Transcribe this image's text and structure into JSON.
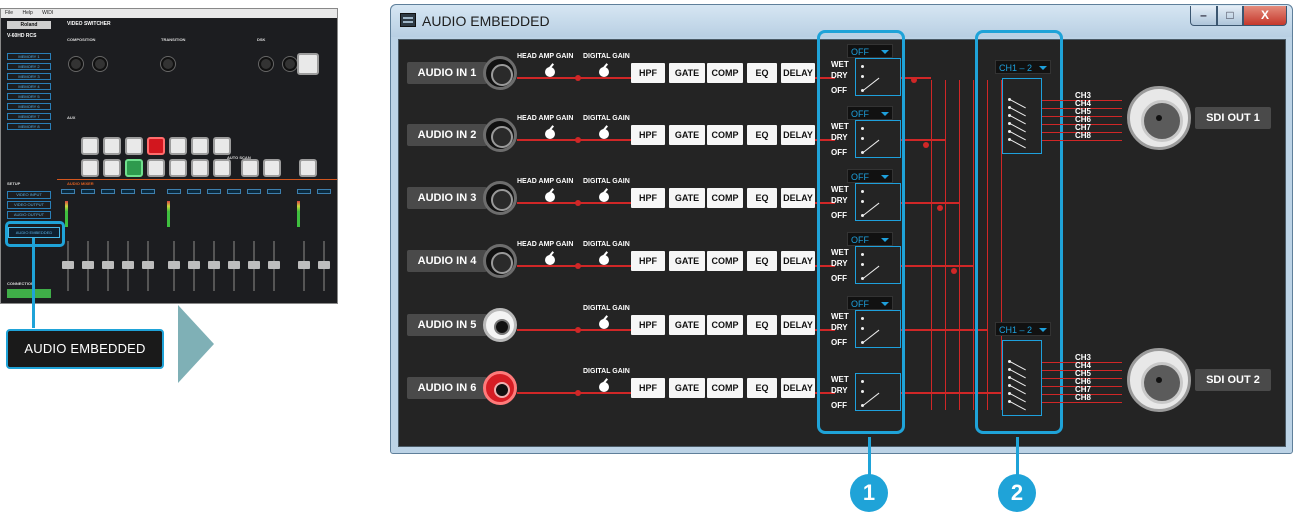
{
  "thumbnail": {
    "menu": [
      "File",
      "Help",
      "WIDI"
    ],
    "title": "VIDEO SWITCHER",
    "brand": "Roland",
    "model": "V-60HD RCS",
    "memory_items": [
      "MEMORY 1",
      "MEMORY 2",
      "MEMORY 3",
      "MEMORY 4",
      "MEMORY 5",
      "MEMORY 6",
      "MEMORY 7",
      "MEMORY 8"
    ],
    "sections": {
      "composition": "COMPOSITION",
      "transition": "TRANSITION",
      "dsk": "DSK",
      "aux": "AUX",
      "audio_mixer": "AUDIO MIXER",
      "setup": "SETUP",
      "auto_scan": "AUTO SCAN"
    },
    "setup_items": [
      "VIDEO INPUT",
      "VIDEO OUTPUT",
      "AUDIO OUTPUT"
    ],
    "highlighted_item": "AUDIO EMBEDDED",
    "connect_label": "CONNECTION"
  },
  "callout_label": "AUDIO EMBEDDED",
  "window": {
    "title": "AUDIO EMBEDDED",
    "controls": {
      "minimize": "–",
      "maximize": "□",
      "close": "X"
    }
  },
  "labels": {
    "head_amp_gain": "HEAD AMP GAIN",
    "digital_gain": "DIGITAL GAIN",
    "wet": "WET",
    "dry": "DRY",
    "off": "OFF"
  },
  "effects": [
    "HPF",
    "GATE",
    "COMP",
    "EQ",
    "DELAY"
  ],
  "inputs": [
    {
      "label": "AUDIO IN 1",
      "jack": "xlr",
      "head_amp": true,
      "mode": "OFF"
    },
    {
      "label": "AUDIO IN 2",
      "jack": "xlr",
      "head_amp": true,
      "mode": "OFF"
    },
    {
      "label": "AUDIO IN 3",
      "jack": "xlr",
      "head_amp": true,
      "mode": "OFF"
    },
    {
      "label": "AUDIO IN 4",
      "jack": "xlr",
      "head_amp": true,
      "mode": "OFF"
    },
    {
      "label": "AUDIO IN 5",
      "jack": "rca-white",
      "head_amp": false,
      "mode": "OFF"
    },
    {
      "label": "AUDIO IN 6",
      "jack": "rca-red",
      "head_amp": false,
      "mode": ""
    }
  ],
  "outputs": [
    {
      "label": "SDI OUT 1",
      "channel_select": "CH1 – 2",
      "channels": [
        "CH3",
        "CH4",
        "CH5",
        "CH6",
        "CH7",
        "CH8"
      ]
    },
    {
      "label": "SDI OUT 2",
      "channel_select": "CH1 – 2",
      "channels": [
        "CH3",
        "CH4",
        "CH5",
        "CH6",
        "CH7",
        "CH8"
      ]
    }
  ],
  "callout_numbers": [
    "1",
    "2"
  ],
  "colors": {
    "highlight": "#1fa3d8",
    "wire": "#d02727",
    "panel": "#242424",
    "selector_text": "#1ea0dc"
  }
}
